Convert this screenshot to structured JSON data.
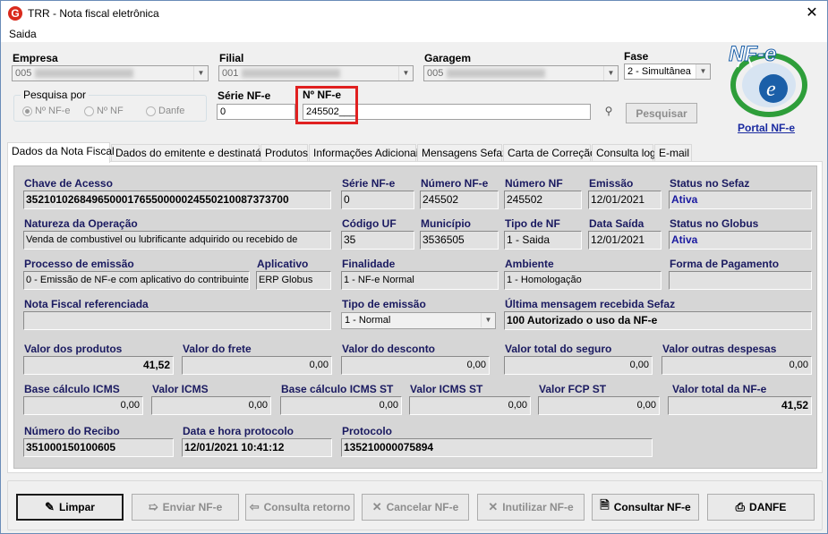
{
  "window": {
    "title": "TRR - Nota fiscal eletrônica",
    "close": "✕"
  },
  "menu": {
    "saida": "Saida"
  },
  "header": {
    "empresa_label": "Empresa",
    "empresa_value": "005",
    "filial_label": "Filial",
    "filial_value": "001",
    "garagem_label": "Garagem",
    "garagem_value": "005",
    "fase_label": "Fase",
    "fase_value": "2 - Simultânea",
    "pesquisa_label": "Pesquisa por",
    "radio_nrnfe": "Nº NF-e",
    "radio_nrnf": "Nº NF",
    "radio_danfe": "Danfe",
    "serie_label": "Série NF-e",
    "serie_value": "0",
    "nrnfe_label": "Nº NF-e",
    "nrnfe_value": "245502___",
    "pesquisar_button": "Pesquisar",
    "portal_link": "Portal NF-e",
    "logo_text": "NF-e"
  },
  "tabs": [
    "Dados da Nota Fiscal",
    "Dados do emitente e destinatário",
    "Produtos",
    "Informações Adicionais",
    "Mensagens Sefaz",
    "Carta de Correção",
    "Consulta log",
    "E-mail"
  ],
  "fields": {
    "chave_label": "Chave de Acesso",
    "chave_value": "35210102684965000176550000024550210087373700",
    "serie_label": "Série NF-e",
    "serie_value": "0",
    "numero_nfe_label": "Número NF-e",
    "numero_nfe_value": "245502",
    "numero_nf_label": "Número NF",
    "numero_nf_value": "245502",
    "emissao_label": "Emissão",
    "emissao_value": "12/01/2021",
    "status_sefaz_label": "Status no Sefaz",
    "status_sefaz_value": "Ativa",
    "natureza_label": "Natureza da Operação",
    "natureza_value": "Venda de combustivel ou lubrificante adquirido ou recebido de",
    "codigo_uf_label": "Código UF",
    "codigo_uf_value": "35",
    "municipio_label": "Município",
    "municipio_value": "3536505",
    "tipo_nf_label": "Tipo de NF",
    "tipo_nf_value": "1 - Saida",
    "data_saida_label": "Data Saída",
    "data_saida_value": "12/01/2021",
    "status_globus_label": "Status no Globus",
    "status_globus_value": "Ativa",
    "processo_label": "Processo de emissão",
    "processo_value": "0 - Emissão de NF-e com aplicativo do contribuinte",
    "aplicativo_label": "Aplicativo",
    "aplicativo_value": "ERP Globus",
    "finalidade_label": "Finalidade",
    "finalidade_value": "1 - NF-e Normal",
    "ambiente_label": "Ambiente",
    "ambiente_value": "1 - Homologação",
    "forma_pag_label": "Forma de Pagamento",
    "forma_pag_value": "",
    "nf_ref_label": "Nota Fiscal referenciada",
    "nf_ref_value": "",
    "tipo_emissao_label": "Tipo de emissão",
    "tipo_emissao_value": "1 - Normal",
    "ultima_msg_label": "Última mensagem recebida Sefaz",
    "ultima_msg_value": "100 Autorizado o uso da NF-e",
    "valor_produtos_label": "Valor dos produtos",
    "valor_produtos_value": "41,52",
    "valor_frete_label": "Valor do frete",
    "valor_frete_value": "0,00",
    "valor_desconto_label": "Valor do desconto",
    "valor_desconto_value": "0,00",
    "valor_seguro_label": "Valor total do seguro",
    "valor_seguro_value": "0,00",
    "valor_outras_label": "Valor outras despesas",
    "valor_outras_value": "0,00",
    "base_icms_label": "Base cálculo ICMS",
    "base_icms_value": "0,00",
    "valor_icms_label": "Valor ICMS",
    "valor_icms_value": "0,00",
    "base_icms_st_label": "Base cálculo ICMS ST",
    "base_icms_st_value": "0,00",
    "valor_icms_st_label": "Valor ICMS ST",
    "valor_icms_st_value": "0,00",
    "valor_fcp_label": "Valor FCP ST",
    "valor_fcp_value": "0,00",
    "valor_total_label": "Valor total da NF-e",
    "valor_total_value": "41,52",
    "recibo_label": "Número do Recibo",
    "recibo_value": "351000150100605",
    "data_protocolo_label": "Data e hora protocolo",
    "data_protocolo_value": "12/01/2021 10:41:12",
    "protocolo_label": "Protocolo",
    "protocolo_value": "135210000075894"
  },
  "buttons": {
    "limpar": "Limpar",
    "enviar": "Enviar NF-e",
    "consulta_retorno": "Consulta retorno",
    "cancelar": "Cancelar NF-e",
    "inutilizar": "Inutilizar NF-e",
    "consultar": "Consultar NF-e",
    "danfe": "DANFE"
  },
  "colors": {
    "accent_red": "#e02020",
    "value_blue": "#1a1aa0",
    "logo_green": "#2e9e3a",
    "logo_blue": "#1b5fa8"
  }
}
